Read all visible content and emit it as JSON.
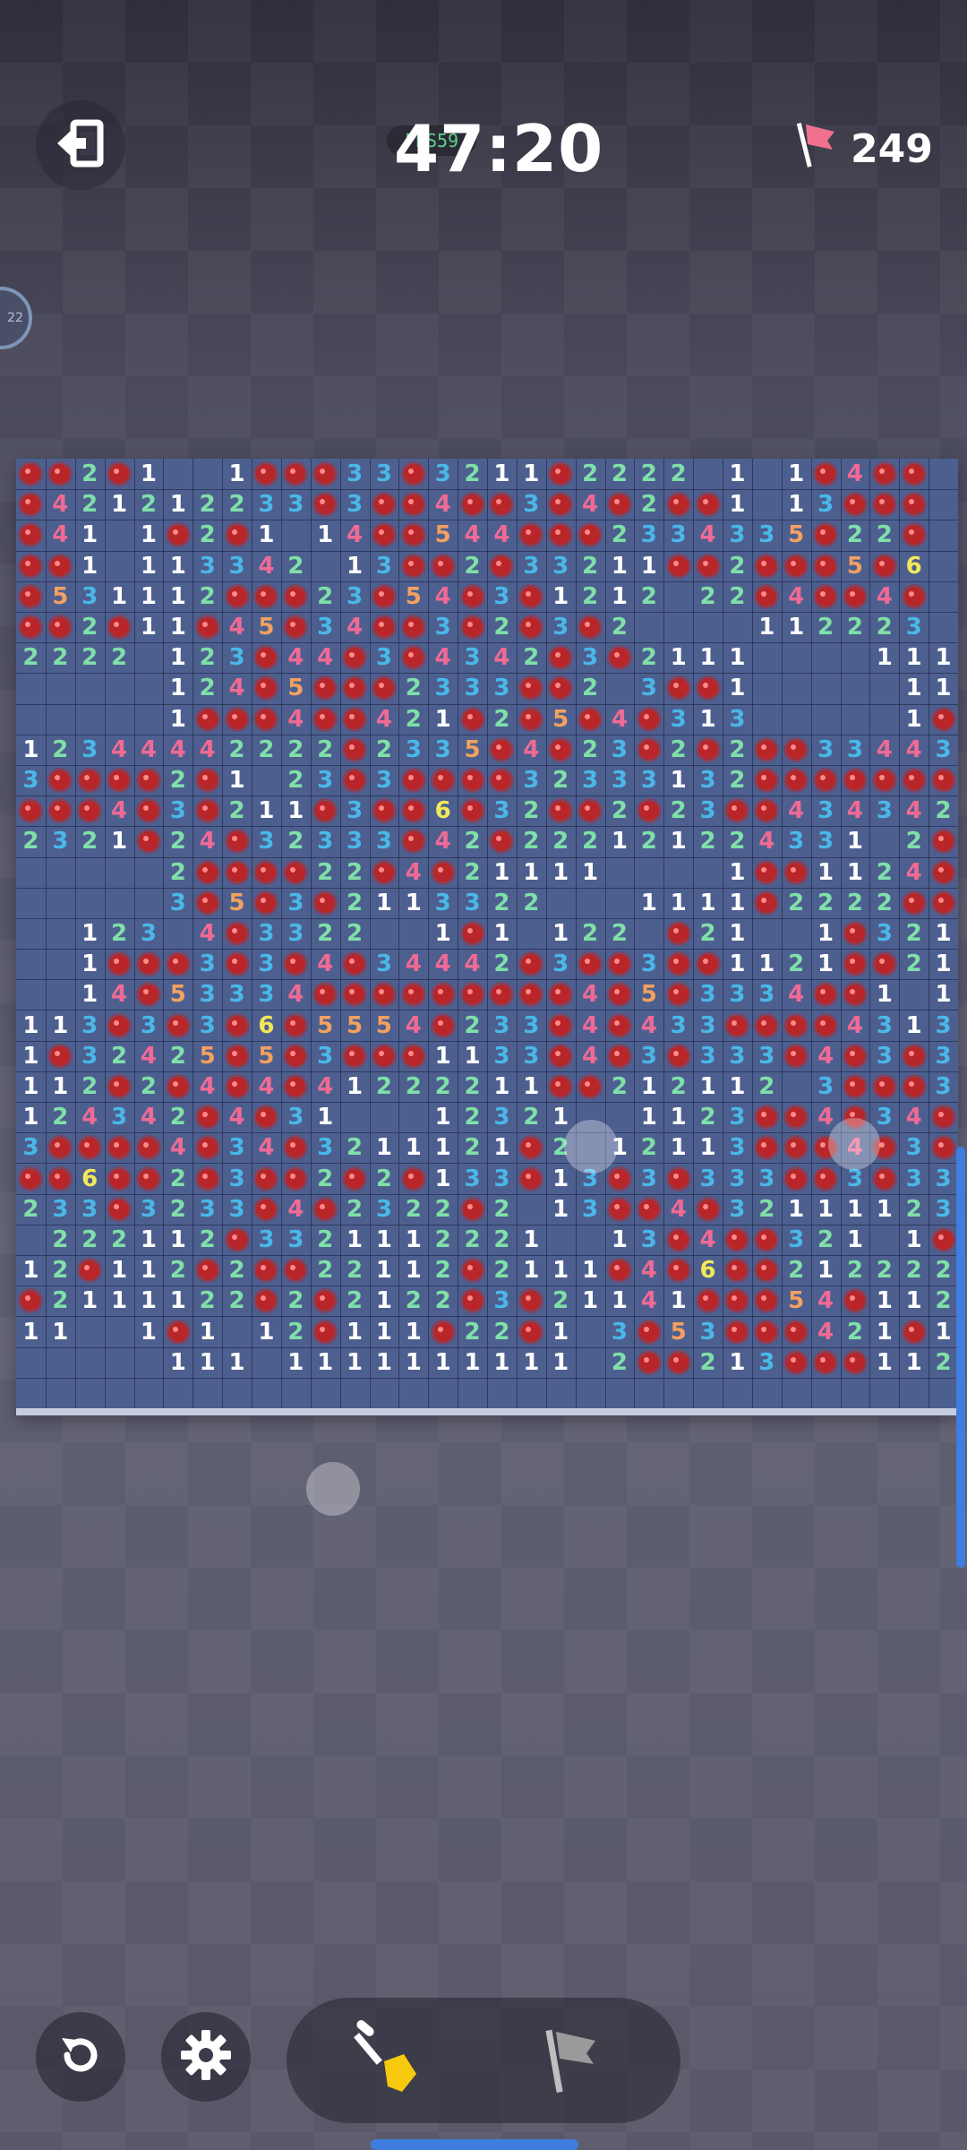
{
  "header": {
    "exit_icon": "exit-icon",
    "fps_text": "FPS59",
    "timer": "47:20",
    "flag_icon": "flag-icon",
    "flags_remaining": "249",
    "side_badge": "22"
  },
  "board": {
    "cols": 32,
    "rows": 31,
    "number_colors": {
      "1": "#ffffff",
      "2": "#7fe0a8",
      "3": "#49b8e8",
      "4": "#f06a94",
      "5": "#f3a060",
      "6": "#f2e85a"
    },
    "cells": [
      "MM2M1..1MMM33M3211M2222.1.1M4MM",
      "M421212233M3MM4MM3M4M2MM1.13MMM",
      "M41.1M2M1.14MM544MMM2334335M22M",
      "MM1.113342.13MM2M33211MM2MMM5M6",
      "M531112MMM23M54M3M1212.22M4MM4M",
      "MM2M11M45M34MM3M2M3M2....112223",
      "2222.123M44M3M4342M3M2111....111",
      ".....124M5MMM2333MM2.3MM1.....111",
      ".....1MMM4MM421M2M5M4M313.....1M1",
      "12344442222M2335M4M23M2M2MM33443",
      "3MMMM2M1.23M3MMMM32333132MMMMMMM",
      "MMM4M3M211M3MM6M32MM2M23MM4343422",
      "2321M24M32333M42M222121224331.2M3",
      ".....2MMMM22M4M21111....1MM1124MM",
      ".....3M5M3M2113322...1111M2222MM32",
      "..123.4M3322..1M1.122.M21..1M321.",
      "..1MMM3M3M4M34442M3MM3MM1121MM2122",
      "..14M53334MMMMMMMMM4M5M3334MM1.1MM",
      "113M3M3M6M5554M233M4M433MMMM4313M3",
      "1M32425M5M3MMM1133M4M3M333M4M3M3M1",
      "112M2M4M4M41222211MM212112.3MMM3222",
      "124342M4M31...12321..1123MM4M34M",
      "3MMMM4M34M3211121M2.12113MMM4M3MMM",
      "MM6MM2M3MM2M2M133M13M3M333MM3M33",
      "233M3233M4M2322M2.13MM4M3211112333",
      ".222112M3321112221..13M4MM321.1MMM1",
      "12M112M2MM22112M2111M4M6MM21222221",
      "M2111122M2M2122M3M21141MMM54M1122",
      "11..1M1.12M111M22M1.3M53MMM421M1M",
      ".....111.1111111111.2MM213MMM112",
      "................................"
    ]
  },
  "controls": {
    "restart_icon": "restart-icon",
    "settings_icon": "gear-icon",
    "dig_tool_icon": "shovel-icon",
    "flag_tool_icon": "flag-tool-icon"
  }
}
